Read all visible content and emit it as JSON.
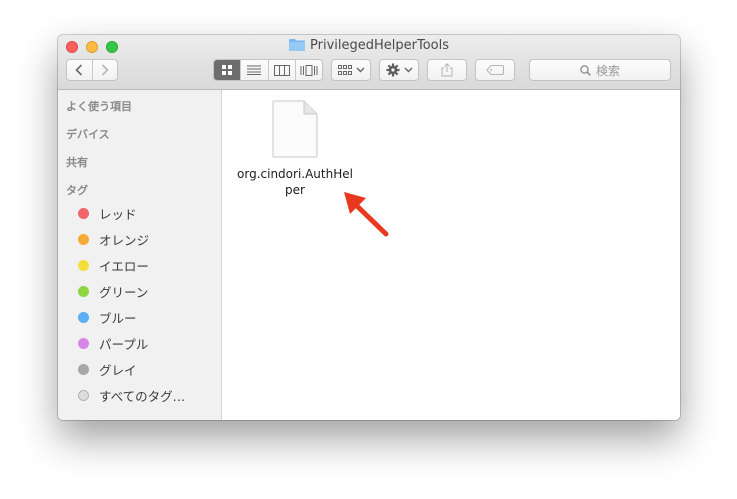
{
  "window": {
    "title": "PrivilegedHelperTools"
  },
  "toolbar": {
    "search_placeholder": "検索"
  },
  "sidebar": {
    "sections": {
      "favorites": "よく使う項目",
      "devices": "デバイス",
      "shared": "共有",
      "tags": "タグ"
    },
    "tags": [
      {
        "label": "レッド",
        "color": "#f0666a"
      },
      {
        "label": "オレンジ",
        "color": "#f6a935"
      },
      {
        "label": "イエロー",
        "color": "#f5dd3b"
      },
      {
        "label": "グリーン",
        "color": "#8ed53f"
      },
      {
        "label": "ブルー",
        "color": "#5aaef5"
      },
      {
        "label": "パープル",
        "color": "#d586e6"
      },
      {
        "label": "グレイ",
        "color": "#a7a7a7"
      },
      {
        "label": "すべてのタグ…",
        "color": "#dddddd"
      }
    ]
  },
  "content": {
    "file_name": "org.cindori.AuthHelper"
  },
  "annotation": {
    "arrow_color": "#e8391f"
  }
}
